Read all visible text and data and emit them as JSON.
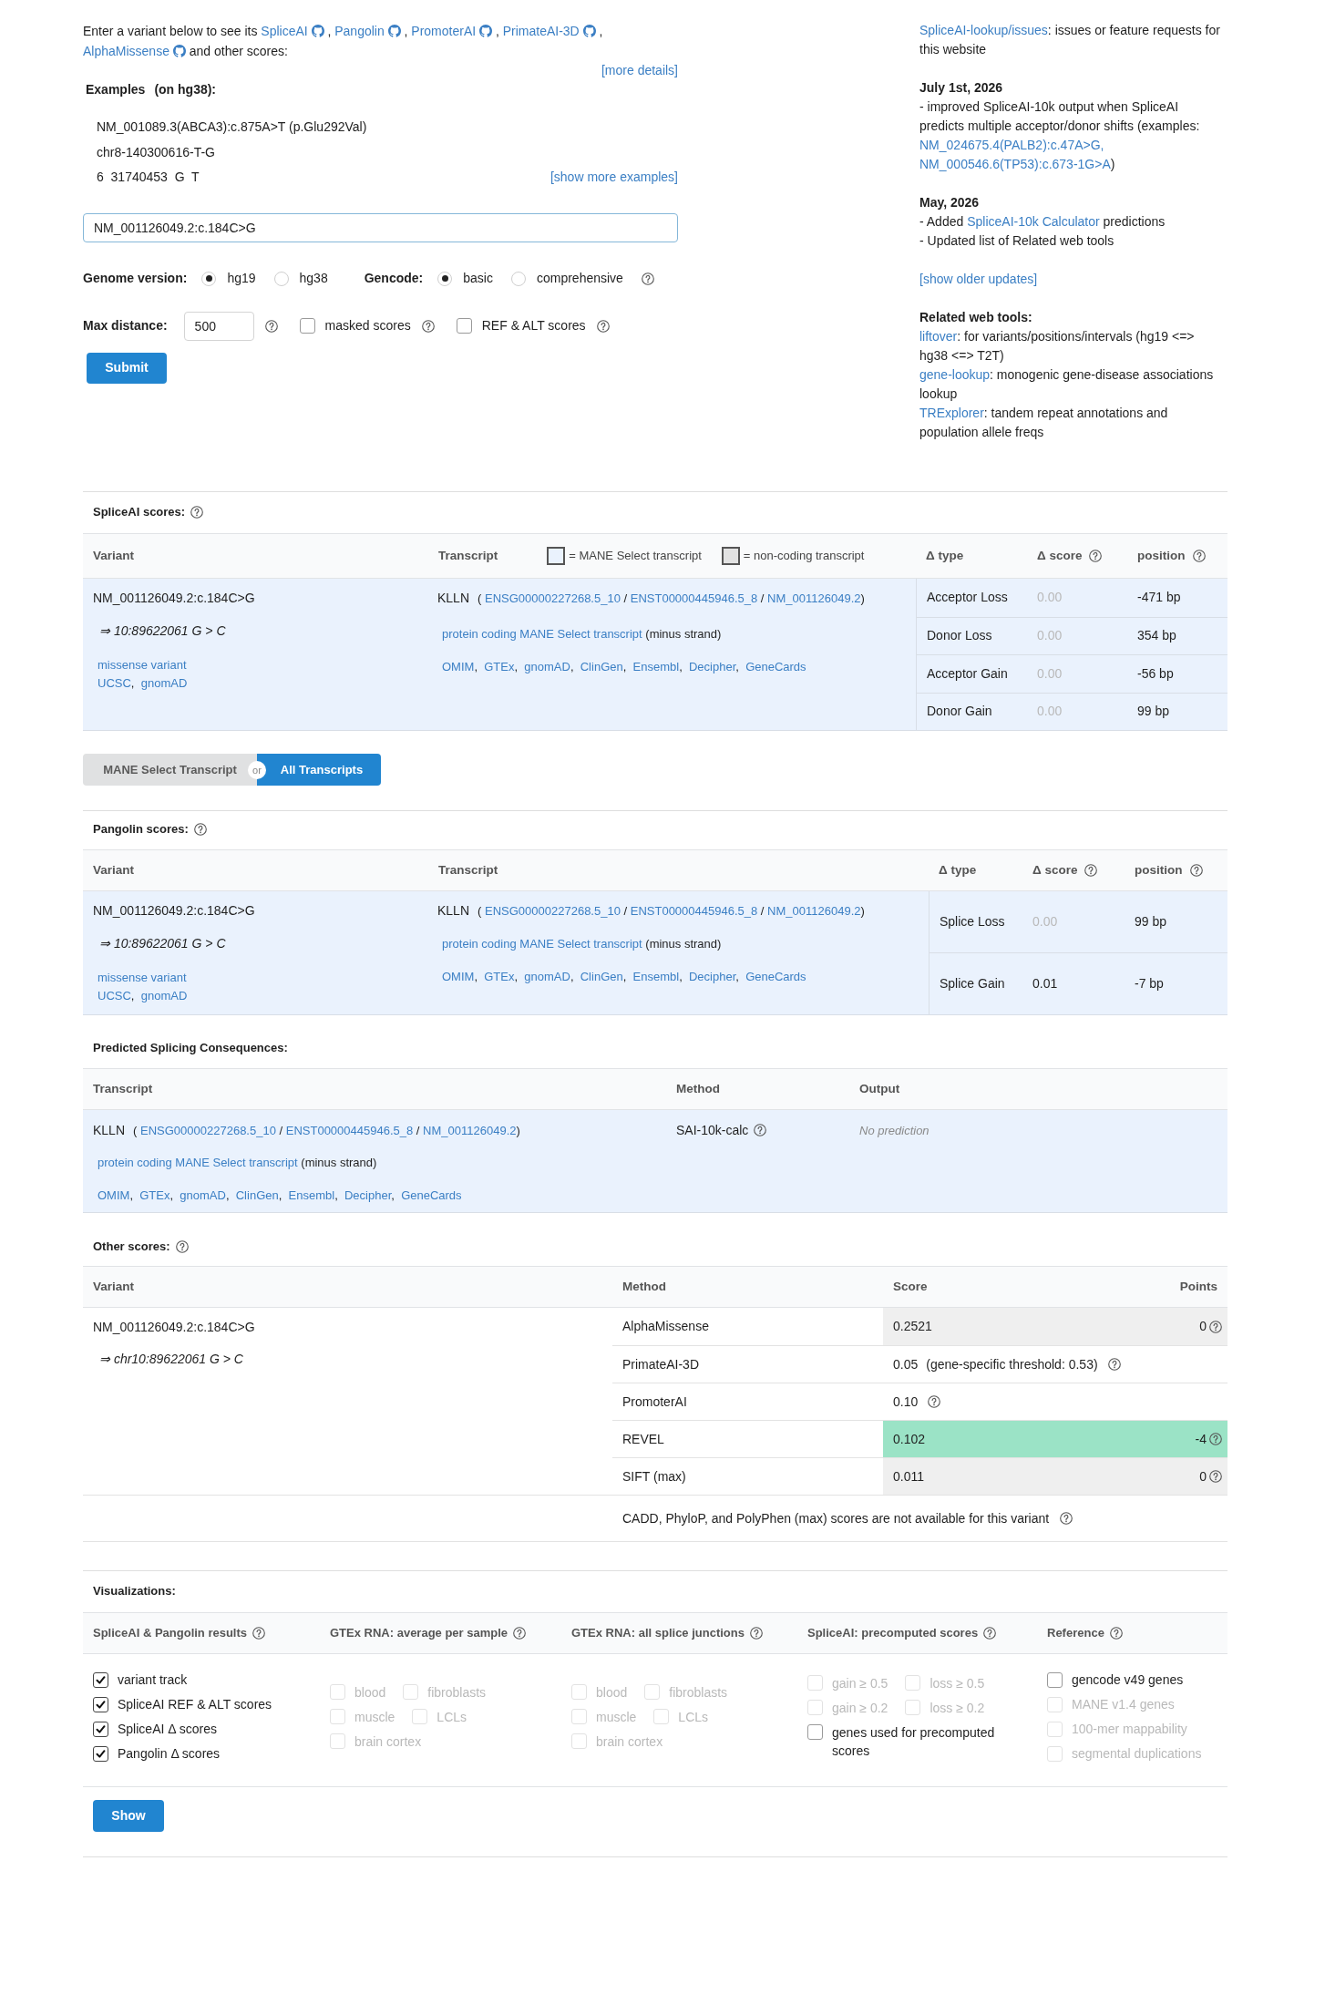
{
  "intro": {
    "lead": "Enter a variant below to see its",
    "tools": [
      {
        "label": "SpliceAI",
        "sep": ","
      },
      {
        "label": "Pangolin",
        "sep": ","
      },
      {
        "label": "PromoterAI",
        "sep": ","
      },
      {
        "label": "PrimateAI-3D",
        "sep": ","
      },
      {
        "label": "AlphaMissense"
      }
    ],
    "tail": "and other scores:",
    "details_link": "[more details]"
  },
  "examples": {
    "title": "Examples",
    "note": "(on hg38):",
    "items": [
      "NM_001089.3(ABCA3):c.875A>T (p.Glu292Val)",
      "chr8-140300616-T-G",
      "6  31740453  G  T"
    ],
    "more_link": "[show more examples]"
  },
  "form": {
    "variant_input": {
      "value": "NM_001126049.2:c.184C>G"
    },
    "genome_version": {
      "label": "Genome version:",
      "options": [
        {
          "label": "hg19",
          "selected": true
        },
        {
          "label": "hg38",
          "selected": false
        }
      ]
    },
    "gencode": {
      "label": "Gencode:",
      "options": [
        {
          "label": "basic",
          "selected": true
        },
        {
          "label": "comprehensive",
          "selected": false
        }
      ]
    },
    "max_distance": {
      "label": "Max distance:",
      "value": "500"
    },
    "checkboxes": [
      {
        "label": "masked scores",
        "checked": false
      },
      {
        "label": "REF & ALT scores",
        "checked": false
      }
    ],
    "submit": "Submit"
  },
  "sidebar": {
    "issues": [
      {
        "kind": "link",
        "text": "SpliceAI-lookup/issues"
      },
      {
        "kind": "text",
        "text": ": issues or feature requests for this website"
      }
    ],
    "updates": [
      {
        "date": "July 1st, 2026",
        "lines": [
          [
            {
              "kind": "text",
              "text": "- improved SpliceAI-10k output when SpliceAI predicts multiple acceptor/donor shifts (examples: "
            },
            {
              "kind": "link",
              "text": "NM_024675.4(PALB2):c.47A>G,"
            },
            {
              "kind": "link",
              "text": "NM_000546.6(TP53):c.673-1G>A"
            },
            {
              "kind": "text",
              "text": ")"
            }
          ]
        ]
      },
      {
        "date": "May, 2026",
        "lines": [
          [
            {
              "kind": "text",
              "text": "- Added "
            },
            {
              "kind": "link",
              "text": "SpliceAI-10k Calculator"
            },
            {
              "kind": "text",
              "text": " predictions"
            }
          ],
          [
            {
              "kind": "text",
              "text": "- Updated list of Related web tools"
            }
          ]
        ]
      }
    ],
    "older_link": "[show older updates]",
    "related": {
      "title": "Related web tools:",
      "items": [
        [
          {
            "kind": "link",
            "text": "liftover"
          },
          {
            "kind": "text",
            "text": ": for variants/positions/intervals (hg19 <=> hg38 <=> T2T)"
          }
        ],
        [
          {
            "kind": "link",
            "text": "gene-lookup"
          },
          {
            "kind": "text",
            "text": ": monogenic gene-disease associations lookup"
          }
        ],
        [
          {
            "kind": "link",
            "text": "TRExplorer"
          },
          {
            "kind": "text",
            "text": ": tandem repeat annotations and population allele freqs"
          }
        ]
      ]
    }
  },
  "spliceai": {
    "title": "SpliceAI scores:",
    "help": true,
    "columns": [
      {
        "label": "Variant"
      },
      {
        "label": "Transcript"
      },
      {
        "label": "Δ type"
      },
      {
        "label": "Δ score",
        "help": true
      },
      {
        "label": "position",
        "help": true
      }
    ],
    "legend": [
      {
        "kind": "mane",
        "label": "= MANE Select transcript"
      },
      {
        "kind": "noncoding",
        "label": "= non-coding transcript"
      }
    ],
    "variant": {
      "name": "NM_001126049.2:c.184C>G",
      "position": "⇒ 10:89622061 G > C",
      "consequence": "missense variant",
      "links": [
        {
          "label": "UCSC",
          "sep": ","
        },
        {
          "label": "gnomAD"
        }
      ]
    },
    "transcript": {
      "gene": "KLLN",
      "open": "(",
      "ids": [
        {
          "label": "ENSG00000227268.5_10",
          "sep": "/"
        },
        {
          "label": "ENST00000445946.5_8",
          "sep": "/"
        },
        {
          "label": "NM_001126049.2"
        }
      ],
      "close": ")",
      "tags": [
        "protein coding",
        "MANE Select transcript"
      ],
      "strand": "(minus strand)",
      "links": [
        {
          "label": "OMIM",
          "sep": ","
        },
        {
          "label": "GTEx",
          "sep": ","
        },
        {
          "label": "gnomAD",
          "sep": ","
        },
        {
          "label": "ClinGen",
          "sep": ","
        },
        {
          "label": "Ensembl",
          "sep": ","
        },
        {
          "label": "Decipher",
          "sep": ","
        },
        {
          "label": "GeneCards"
        }
      ]
    },
    "scores": [
      {
        "type": "Acceptor Loss",
        "score": "0.00",
        "muted": true,
        "position": "-471 bp"
      },
      {
        "type": "Donor Loss",
        "score": "0.00",
        "muted": true,
        "position": "354 bp"
      },
      {
        "type": "Acceptor Gain",
        "score": "0.00",
        "muted": true,
        "position": "-56 bp"
      },
      {
        "type": "Donor Gain",
        "score": "0.00",
        "muted": true,
        "position": "99 bp"
      }
    ]
  },
  "transcript_toggle": {
    "options": [
      {
        "label": "MANE Select Transcript",
        "selected": false
      },
      {
        "label": "All Transcripts",
        "selected": true
      }
    ],
    "connector": "or"
  },
  "pangolin": {
    "title": "Pangolin scores:",
    "help": true,
    "columns": [
      {
        "label": "Variant"
      },
      {
        "label": "Transcript"
      },
      {
        "label": "Δ type"
      },
      {
        "label": "Δ score",
        "help": true
      },
      {
        "label": "position",
        "help": true
      }
    ],
    "variant": {
      "name": "NM_001126049.2:c.184C>G",
      "position": "⇒ 10:89622061 G > C",
      "consequence": "missense variant",
      "links": [
        {
          "label": "UCSC",
          "sep": ","
        },
        {
          "label": "gnomAD"
        }
      ]
    },
    "transcript": {
      "gene": "KLLN",
      "open": "(",
      "ids": [
        {
          "label": "ENSG00000227268.5_10",
          "sep": "/"
        },
        {
          "label": "ENST00000445946.5_8",
          "sep": "/"
        },
        {
          "label": "NM_001126049.2"
        }
      ],
      "close": ")",
      "tags": [
        "protein coding",
        "MANE Select transcript"
      ],
      "strand": "(minus strand)",
      "links": [
        {
          "label": "OMIM",
          "sep": ","
        },
        {
          "label": "GTEx",
          "sep": ","
        },
        {
          "label": "gnomAD",
          "sep": ","
        },
        {
          "label": "ClinGen",
          "sep": ","
        },
        {
          "label": "Ensembl",
          "sep": ","
        },
        {
          "label": "Decipher",
          "sep": ","
        },
        {
          "label": "GeneCards"
        }
      ]
    },
    "scores": [
      {
        "type": "Splice Loss",
        "score": "0.00",
        "muted": true,
        "position": "99 bp"
      },
      {
        "type": "Splice Gain",
        "score": "0.01",
        "muted": false,
        "position": "-7 bp"
      }
    ]
  },
  "predicted": {
    "title": "Predicted Splicing Consequences:",
    "columns": [
      {
        "label": "Transcript"
      },
      {
        "label": "Method"
      },
      {
        "label": "Output"
      }
    ],
    "rows": [
      {
        "transcript": {
          "gene": "KLLN",
          "open": "(",
          "ids": [
            {
              "label": "ENSG00000227268.5_10",
              "sep": "/"
            },
            {
              "label": "ENST00000445946.5_8",
              "sep": "/"
            },
            {
              "label": "NM_001126049.2"
            }
          ],
          "close": ")",
          "tags": [
            "protein coding",
            "MANE Select transcript"
          ],
          "strand": "(minus strand)",
          "links": [
            {
              "label": "OMIM",
              "sep": ","
            },
            {
              "label": "GTEx",
              "sep": ","
            },
            {
              "label": "gnomAD",
              "sep": ","
            },
            {
              "label": "ClinGen",
              "sep": ","
            },
            {
              "label": "Ensembl",
              "sep": ","
            },
            {
              "label": "Decipher",
              "sep": ","
            },
            {
              "label": "GeneCards"
            }
          ]
        },
        "method": "SAI-10k-calc",
        "method_help": true,
        "output": "No prediction"
      }
    ]
  },
  "other": {
    "title": "Other scores:",
    "help": true,
    "columns": [
      {
        "label": "Variant"
      },
      {
        "label": "Method"
      },
      {
        "label": "Score"
      },
      {
        "label": "Points"
      }
    ],
    "variant": {
      "name": "NM_001126049.2:c.184C>G",
      "position": "⇒ chr10:89622061 G > C"
    },
    "rows": [
      {
        "method": "AlphaMissense",
        "score": "0.2521",
        "points": "0",
        "color": "#efefef"
      },
      {
        "method": "PrimateAI-3D",
        "score": "0.05",
        "note": "(gene-specific threshold: 0.53)"
      },
      {
        "method": "PromoterAI",
        "score": "0.10"
      },
      {
        "method": "REVEL",
        "score": "0.102",
        "points": "-4",
        "color": "#9be3c6"
      },
      {
        "method": "SIFT (max)",
        "score": "0.011",
        "points": "0",
        "color": "#efefef"
      }
    ],
    "note": "CADD, PhyloP, and PolyPhen (max) scores are not available for this variant"
  },
  "visualizations": {
    "title": "Visualizations:",
    "groups": [
      {
        "label": "SpliceAI & Pangolin results",
        "help": true,
        "kind": "list",
        "options": [
          {
            "label": "variant track",
            "checked": true,
            "disabled": false
          },
          {
            "label": "SpliceAI REF & ALT scores",
            "checked": true,
            "disabled": false
          },
          {
            "label": "SpliceAI Δ scores",
            "checked": true,
            "disabled": false
          },
          {
            "label": "Pangolin Δ scores",
            "checked": true,
            "disabled": false
          }
        ]
      },
      {
        "label": "GTEx RNA: average per sample",
        "help": true,
        "kind": "grid",
        "options": [
          {
            "label": "blood",
            "checked": false,
            "disabled": true
          },
          {
            "label": "fibroblasts",
            "checked": false,
            "disabled": true
          },
          {
            "label": "muscle",
            "checked": false,
            "disabled": true
          },
          {
            "label": "LCLs",
            "checked": false,
            "disabled": true
          },
          {
            "label": "brain cortex",
            "checked": false,
            "disabled": true
          }
        ]
      },
      {
        "label": "GTEx RNA: all splice junctions",
        "help": true,
        "kind": "grid",
        "options": [
          {
            "label": "blood",
            "checked": false,
            "disabled": true
          },
          {
            "label": "fibroblasts",
            "checked": false,
            "disabled": true
          },
          {
            "label": "muscle",
            "checked": false,
            "disabled": true
          },
          {
            "label": "LCLs",
            "checked": false,
            "disabled": true
          },
          {
            "label": "brain cortex",
            "checked": false,
            "disabled": true
          }
        ]
      },
      {
        "label": "SpliceAI: precomputed scores",
        "help": true,
        "kind": "grid",
        "options": [
          {
            "label": "gain ≥ 0.5",
            "checked": false,
            "disabled": true
          },
          {
            "label": "loss ≥ 0.5",
            "checked": false,
            "disabled": true
          },
          {
            "label": "gain ≥ 0.2",
            "checked": false,
            "disabled": true
          },
          {
            "label": "loss ≥ 0.2",
            "checked": false,
            "disabled": true
          },
          {
            "label": "genes used for precomputed scores",
            "checked": false,
            "disabled": false,
            "wide": true
          }
        ]
      },
      {
        "label": "Reference",
        "help": true,
        "kind": "list",
        "options": [
          {
            "label": "gencode v49 genes",
            "checked": false,
            "disabled": false
          },
          {
            "label": "MANE v1.4 genes",
            "checked": false,
            "disabled": true
          },
          {
            "label": "100-mer mappability",
            "checked": false,
            "disabled": true
          },
          {
            "label": "segmental duplications",
            "checked": false,
            "disabled": true
          }
        ]
      }
    ],
    "show": "Show"
  }
}
